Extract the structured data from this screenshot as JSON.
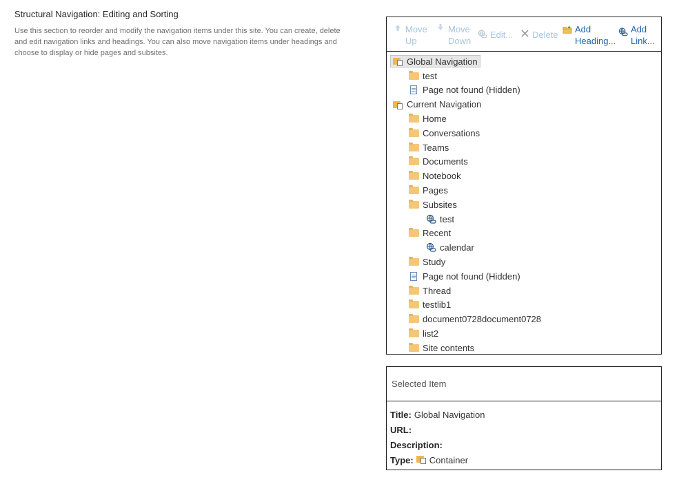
{
  "section": {
    "title": "Structural Navigation: Editing and Sorting",
    "description": "Use this section to reorder and modify the navigation items under this site. You can create, delete and edit navigation links and headings. You can also move navigation items under headings and choose to display or hide pages and subsites."
  },
  "toolbar": {
    "move_up": "Move\nUp",
    "move_down": "Move\nDown",
    "edit": "Edit...",
    "delete": "Delete",
    "add_heading": "Add\nHeading...",
    "add_link": "Add\nLink..."
  },
  "tree": {
    "global_navigation": "Global Navigation",
    "global_items": [
      "test",
      "Page not found (Hidden)"
    ],
    "current_navigation": "Current Navigation",
    "current_items": [
      "Home",
      "Conversations",
      "Teams",
      "Documents",
      "Notebook",
      "Pages",
      "Subsites",
      "test",
      "Recent",
      "calendar",
      "Study",
      "Page not found (Hidden)",
      "Thread",
      "testlib1",
      "document0728document0728",
      "list2",
      "Site contents"
    ]
  },
  "selected_item": {
    "header": "Selected Item",
    "title_label": "Title:",
    "title_value": "Global Navigation",
    "url_label": "URL:",
    "description_label": "Description:",
    "type_label": "Type:",
    "type_value": "Container"
  }
}
